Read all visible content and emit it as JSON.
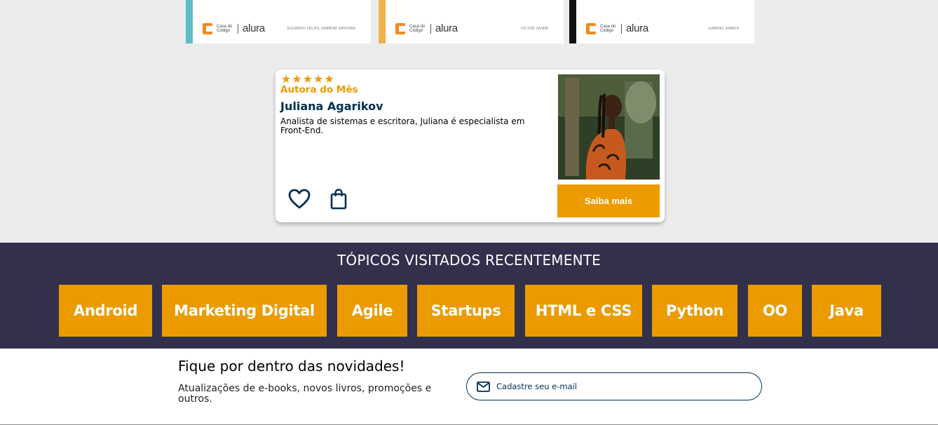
{
  "books": [
    {
      "author": "Eduardo Felipe Zambom Santana",
      "stripe_color": "#5fbcc8",
      "brand_1": "Casa do Código",
      "brand_2": "alura"
    },
    {
      "author": "Victor Zanini",
      "stripe_color": "#f0b24a",
      "brand_1": "Casa do Código",
      "brand_2": "alura"
    },
    {
      "author": "Gabriel Ramos",
      "stripe_color": "#111111",
      "brand_1": "Casa do Código",
      "brand_2": "alura"
    }
  ],
  "author_card": {
    "stars": "★★★★★",
    "tag": "Autora do Mês",
    "name": "Juliana Agarikov",
    "description": "Analista de sistemas e escritora, Juliana é especialista em Front-End.",
    "cta": "Saiba mais"
  },
  "topics": {
    "title": "TÓPICOS VISITADOS RECENTEMENTE",
    "items": [
      "Android",
      "Marketing Digital",
      "Agile",
      "Startups",
      "HTML e CSS",
      "Python",
      "OO",
      "Java"
    ]
  },
  "newsletter": {
    "title": "Fique por dentro das novidades!",
    "description": "Atualizações de e-books, novos livros, promoções e outros.",
    "placeholder": "Cadastre seu e-mail"
  },
  "colors": {
    "accent": "#eb9b00",
    "navy": "#002f52",
    "topics_bg": "#33304c",
    "page_bg": "#ebecee"
  }
}
